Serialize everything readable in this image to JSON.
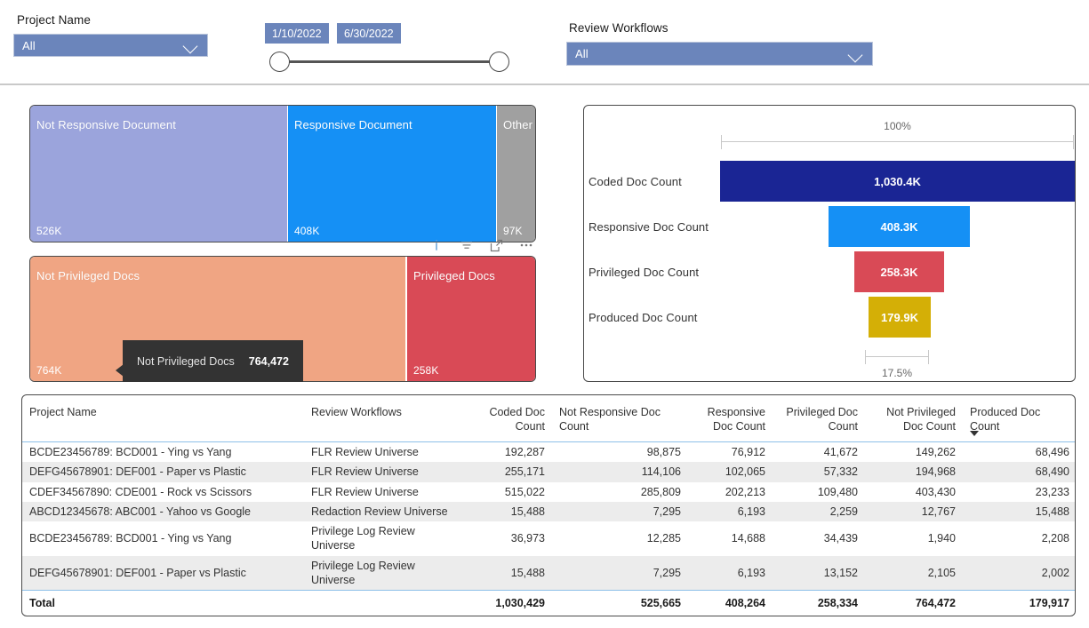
{
  "filters": {
    "project": {
      "label": "Project Name",
      "value": "All"
    },
    "workflow": {
      "label": "Review Workflows",
      "value": "All"
    },
    "date_range": {
      "start": "1/10/2022",
      "end": "6/30/2022"
    }
  },
  "treemap_responsive": {
    "tiles": [
      {
        "label": "Not Responsive Document",
        "value": "526K",
        "color": "#9ba4dc",
        "raw": 525665
      },
      {
        "label": "Responsive Document",
        "value": "408K",
        "color": "#1590f5",
        "raw": 408264
      },
      {
        "label": "Other",
        "value": "97K",
        "color": "#a0a0a0",
        "raw": 96500
      }
    ]
  },
  "treemap_privileged": {
    "tiles": [
      {
        "label": "Not Privileged Docs",
        "value": "764K",
        "color": "#f0a583",
        "raw": 764472
      },
      {
        "label": "Privileged Docs",
        "value": "258K",
        "color": "#d94a56",
        "raw": 258334
      }
    ]
  },
  "tooltip": {
    "label": "Not Privileged Docs",
    "value": "764,472"
  },
  "viz_icons": [
    {
      "name": "info-icon"
    },
    {
      "name": "filter-icon"
    },
    {
      "name": "focus-mode-icon"
    },
    {
      "name": "more-options-icon"
    }
  ],
  "chart_data": {
    "type": "bar",
    "subtype": "funnel",
    "title": "",
    "categories": [
      "Coded Doc Count",
      "Responsive Doc Count",
      "Privileged Doc Count",
      "Produced Doc Count"
    ],
    "values": [
      1030400,
      408300,
      258300,
      179900
    ],
    "labels": [
      "1,030.4K",
      "408.3K",
      "258.3K",
      "179.9K"
    ],
    "colors": [
      "#1a2594",
      "#1590f5",
      "#d94a56",
      "#d4af06"
    ],
    "axis_top_label": "100%",
    "axis_bottom_label": "17.5%",
    "xlabel": "",
    "ylabel": "",
    "legend": "none",
    "grid": false
  },
  "table": {
    "columns": [
      "Project Name",
      "Review Workflows",
      "Coded Doc Count",
      "Not Responsive Doc Count",
      "Responsive Doc Count",
      "Privileged Doc Count",
      "Not Privileged Doc Count",
      "Produced Doc Count"
    ],
    "sorted_column": "Produced Doc Count",
    "rows": [
      {
        "project": "BCDE23456789: BCD001 - Ying vs Yang",
        "workflow": "FLR Review Universe",
        "coded": "192,287",
        "not_responsive": "98,875",
        "responsive": "76,912",
        "privileged": "41,672",
        "not_privileged": "149,262",
        "produced": "68,496"
      },
      {
        "project": "DEFG45678901: DEF001 - Paper vs Plastic",
        "workflow": "FLR Review Universe",
        "coded": "255,171",
        "not_responsive": "114,106",
        "responsive": "102,065",
        "privileged": "57,332",
        "not_privileged": "194,968",
        "produced": "68,490"
      },
      {
        "project": "CDEF34567890: CDE001 - Rock vs Scissors",
        "workflow": "FLR Review Universe",
        "coded": "515,022",
        "not_responsive": "285,809",
        "responsive": "202,213",
        "privileged": "109,480",
        "not_privileged": "403,430",
        "produced": "23,233"
      },
      {
        "project": "ABCD12345678: ABC001 - Yahoo vs Google",
        "workflow": "Redaction Review Universe",
        "coded": "15,488",
        "not_responsive": "7,295",
        "responsive": "6,193",
        "privileged": "2,259",
        "not_privileged": "12,767",
        "produced": "15,488"
      },
      {
        "project": "BCDE23456789: BCD001 - Ying vs Yang",
        "workflow": "Privilege Log Review Universe",
        "coded": "36,973",
        "not_responsive": "12,285",
        "responsive": "14,688",
        "privileged": "34,439",
        "not_privileged": "1,940",
        "produced": "2,208"
      },
      {
        "project": "DEFG45678901: DEF001 - Paper vs Plastic",
        "workflow": "Privilege Log Review Universe",
        "coded": "15,488",
        "not_responsive": "7,295",
        "responsive": "6,193",
        "privileged": "13,152",
        "not_privileged": "2,105",
        "produced": "2,002"
      }
    ],
    "total": {
      "project": "Total",
      "workflow": "",
      "coded": "1,030,429",
      "not_responsive": "525,665",
      "responsive": "408,264",
      "privileged": "258,334",
      "not_privileged": "764,472",
      "produced": "179,917"
    }
  }
}
